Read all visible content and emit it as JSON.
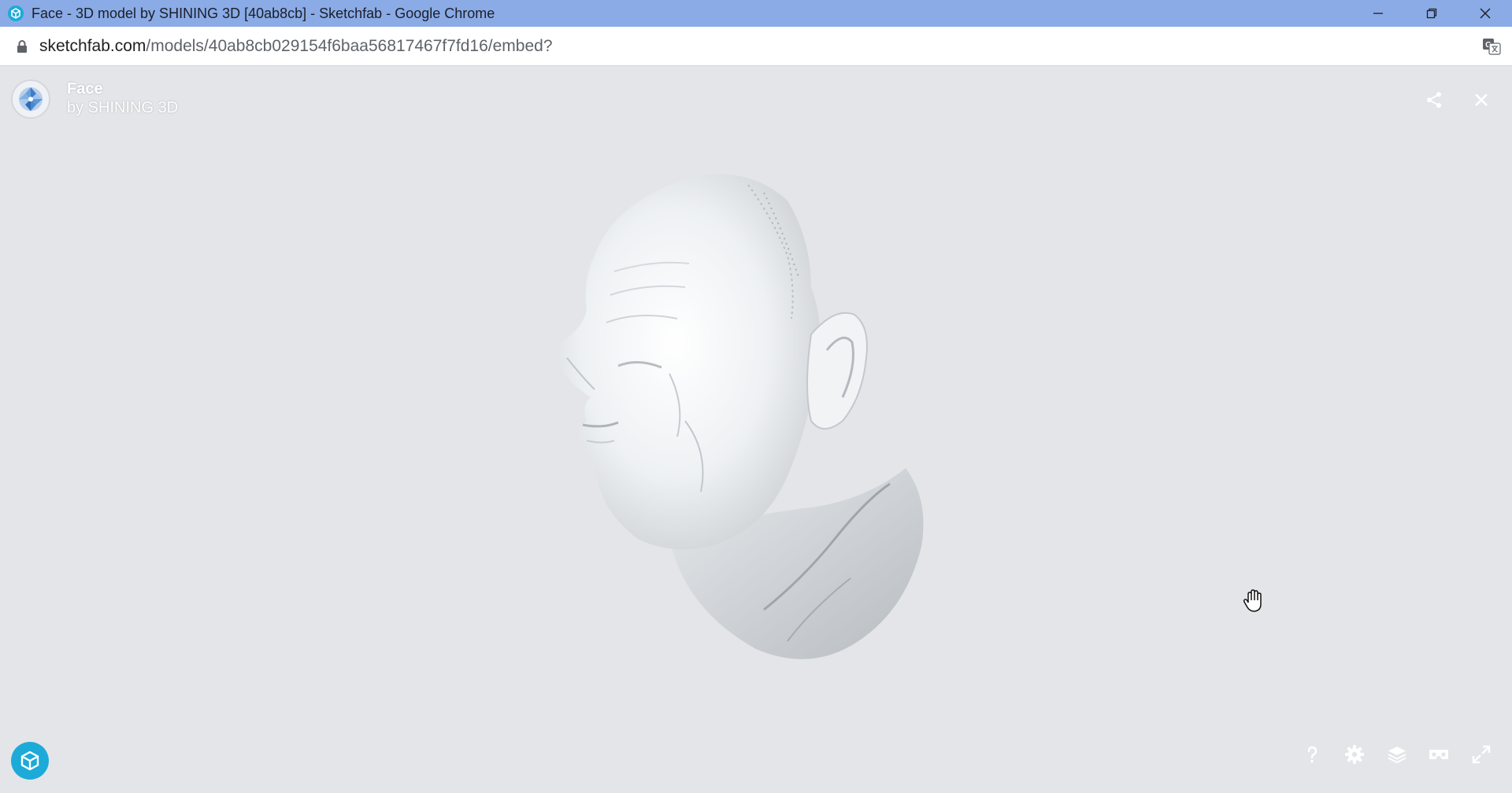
{
  "window": {
    "title": "Face - 3D model by SHINING 3D [40ab8cb] - Sketchfab - Google Chrome",
    "controls": [
      "minimize-icon",
      "restore-icon",
      "close-icon"
    ]
  },
  "addressbar": {
    "domain": "sketchfab.com",
    "path": "/models/40ab8cb029154f6baa56817467f7fd16/embed?"
  },
  "viewer": {
    "model_title": "Face",
    "model_author": "by SHINING 3D",
    "top_icons": [
      "share-icon",
      "close-icon"
    ],
    "bottom_icons": [
      "help-icon",
      "settings-gear-icon",
      "layers-icon",
      "vr-headset-icon",
      "fullscreen-icon"
    ],
    "background": "#e4e5e8",
    "accent": "#1caad9"
  }
}
